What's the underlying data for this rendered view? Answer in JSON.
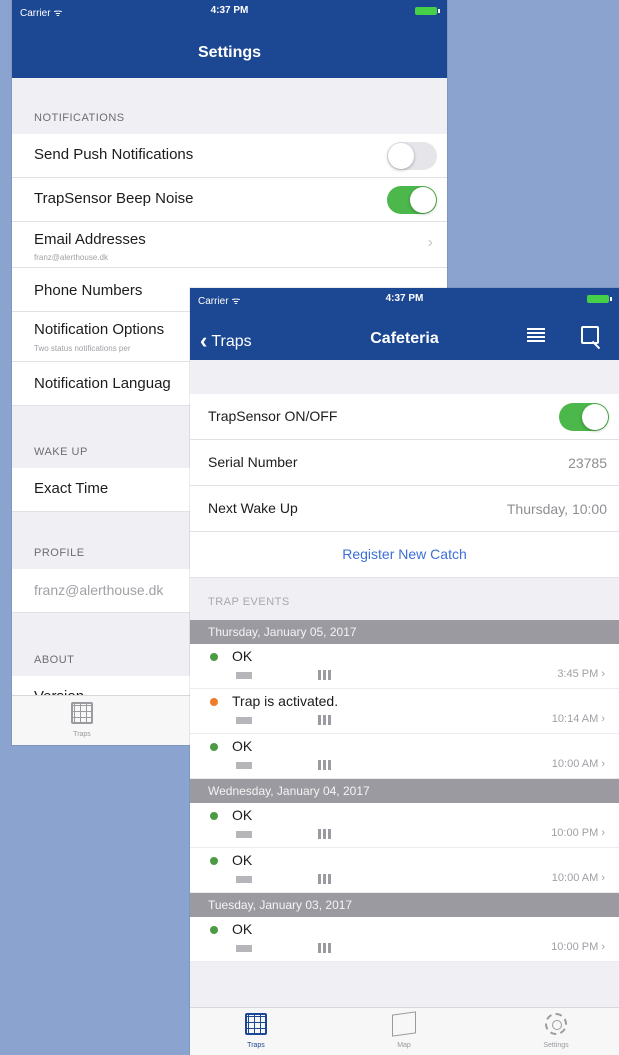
{
  "settings_screen": {
    "status": {
      "carrier": "Carrier ᯤ",
      "time": "4:37 PM"
    },
    "title": "Settings",
    "sections": {
      "notifications": "NOTIFICATIONS",
      "wake_up": "WAKE UP",
      "profile": "PROFILE",
      "about": "ABOUT"
    },
    "rows": {
      "push": "Send Push Notifications",
      "beep": "TrapSensor Beep Noise",
      "email": "Email Addresses",
      "email_sub": "franz@alerthouse.dk",
      "phone": "Phone Numbers",
      "options": "Notification Options",
      "options_sub": "Two status notifications per",
      "language": "Notification Languag",
      "exact_time": "Exact Time",
      "profile_email": "franz@alerthouse.dk",
      "version": "Version"
    },
    "toggles": {
      "push": false,
      "beep": true
    },
    "tab_traps": "Traps"
  },
  "trap_screen": {
    "status": {
      "carrier": "Carrier ᯤ",
      "time": "4:37 PM"
    },
    "back_label": "Traps",
    "title": "Cafeteria",
    "rows": {
      "onoff": "TrapSensor ON/OFF",
      "serial_label": "Serial Number",
      "serial_value": "23785",
      "wake_label": "Next Wake Up",
      "wake_value": "Thursday, 10:00"
    },
    "toggle_on": true,
    "register": "Register New Catch",
    "events_header": "TRAP EVENTS",
    "days": [
      {
        "date": "Thursday, January 05, 2017",
        "events": [
          {
            "title": "OK",
            "time": "3:45 PM ›",
            "status": "green"
          },
          {
            "title": "Trap is activated.",
            "time": "10:14 AM ›",
            "status": "orange"
          },
          {
            "title": "OK",
            "time": "10:00 AM ›",
            "status": "green"
          }
        ]
      },
      {
        "date": "Wednesday, January 04, 2017",
        "events": [
          {
            "title": "OK",
            "time": "10:00 PM ›",
            "status": "green"
          },
          {
            "title": "OK",
            "time": "10:00 AM ›",
            "status": "green"
          }
        ]
      },
      {
        "date": "Tuesday, January 03, 2017",
        "events": [
          {
            "title": "OK",
            "time": "10:00 PM ›",
            "status": "green"
          }
        ]
      }
    ],
    "tabs": [
      "Traps",
      "Map",
      "Settings"
    ],
    "colors": {
      "accent": "#1c4793",
      "toggle_on": "#4cb74a",
      "ok": "#4c9a44",
      "warning": "#f07b2a"
    }
  }
}
